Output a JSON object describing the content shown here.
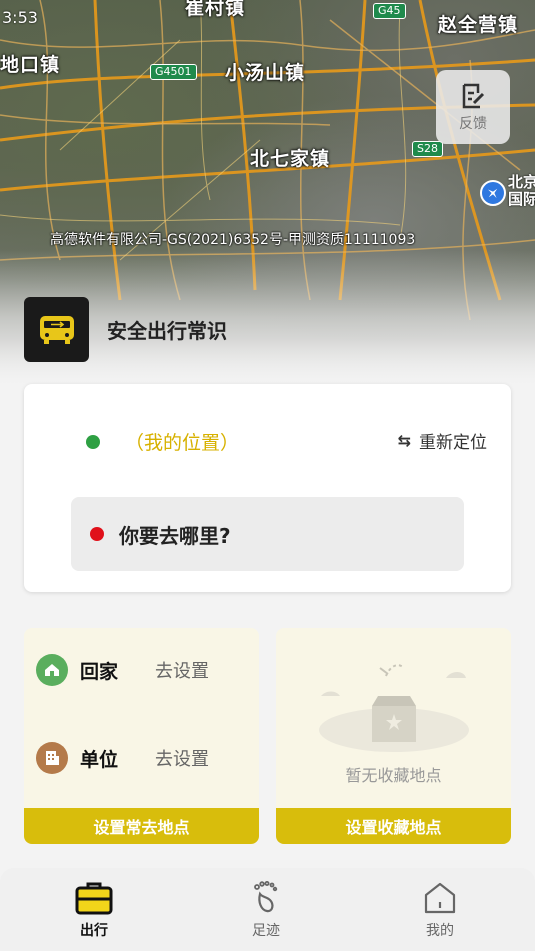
{
  "status": {
    "time": "3:53"
  },
  "map": {
    "towns": [
      "崔村镇",
      "赵全营镇",
      "地口镇",
      "小汤山镇",
      "北七家镇"
    ],
    "highways": [
      "G45",
      "G4501",
      "S28"
    ],
    "airport_label": "北京\n国际",
    "copyright": "高德软件有限公司-GS(2021)6352号-甲测资质11111093"
  },
  "feedback": {
    "label": "反馈",
    "icon": "edit-note-icon"
  },
  "safety": {
    "label": "安全出行常识",
    "icon": "bus-icon"
  },
  "location_card": {
    "my_location": "（我的位置）",
    "relocate": "重新定位",
    "destination_prompt": "你要去哪里?"
  },
  "frequent": {
    "home_label": "回家",
    "home_action": "去设置",
    "work_label": "单位",
    "work_action": "去设置",
    "button": "设置常去地点"
  },
  "favorites": {
    "empty_text": "暂无收藏地点",
    "button": "设置收藏地点"
  },
  "tabs": [
    {
      "label": "出行",
      "icon": "briefcase-icon",
      "active": true
    },
    {
      "label": "足迹",
      "icon": "footprint-icon",
      "active": false
    },
    {
      "label": "我的",
      "icon": "home-icon",
      "active": false
    }
  ],
  "colors": {
    "accent": "#d8bd0c",
    "my_location": "#d7b100",
    "green_dot": "#2ea043",
    "red_dot": "#e0101a"
  }
}
